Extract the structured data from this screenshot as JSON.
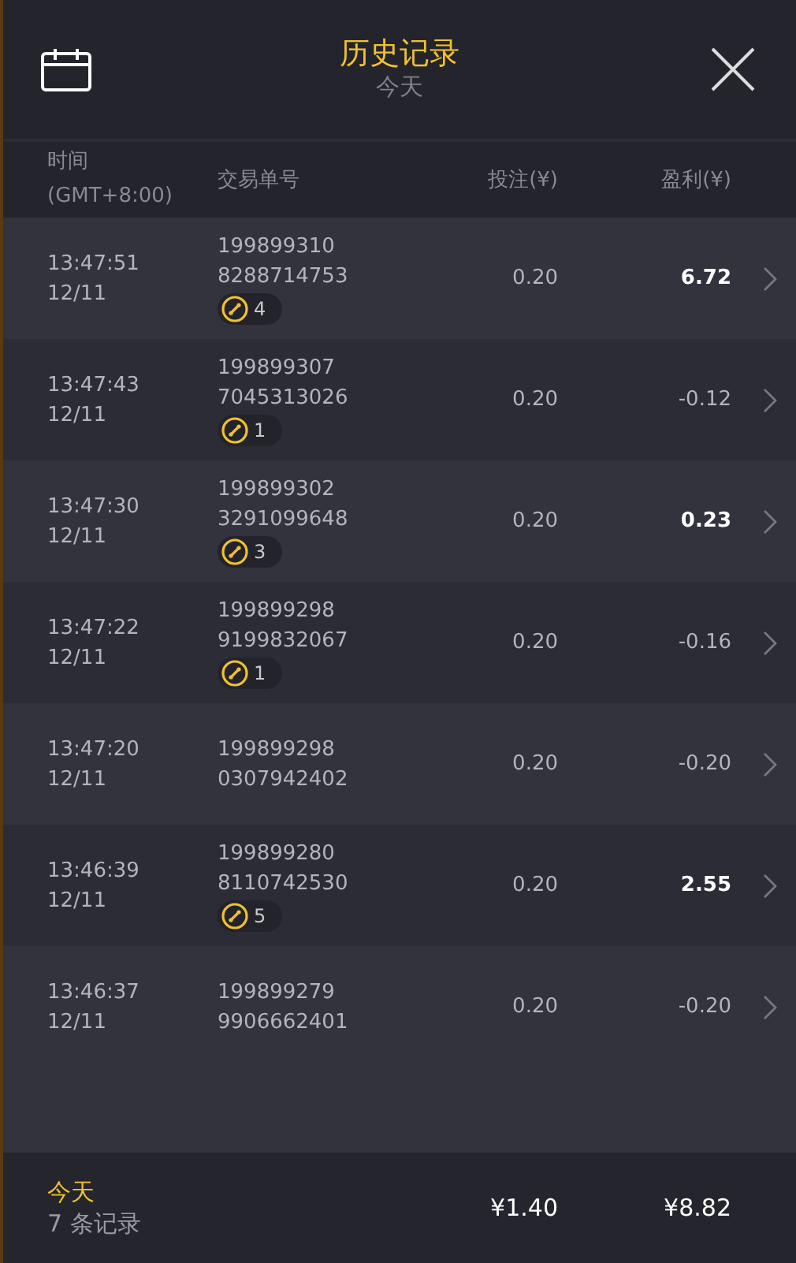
{
  "header": {
    "title": "历史记录",
    "subtitle": "今天"
  },
  "columns": {
    "time": [
      "时间",
      "(GMT+8:00)"
    ],
    "order": "交易单号",
    "stake": "投注(¥)",
    "profit": "盈利(¥)"
  },
  "rows": [
    {
      "time": "13:47:51",
      "date": "12/11",
      "order": [
        "199899310",
        "8288714753"
      ],
      "badge": "4",
      "stake": "0.20",
      "profit": "6.72",
      "highlighted": true
    },
    {
      "time": "13:47:43",
      "date": "12/11",
      "order": [
        "199899307",
        "7045313026"
      ],
      "badge": "1",
      "stake": "0.20",
      "profit": "-0.12",
      "highlighted": false
    },
    {
      "time": "13:47:30",
      "date": "12/11",
      "order": [
        "199899302",
        "3291099648"
      ],
      "badge": "3",
      "stake": "0.20",
      "profit": "0.23",
      "highlighted": true
    },
    {
      "time": "13:47:22",
      "date": "12/11",
      "order": [
        "199899298",
        "9199832067"
      ],
      "badge": "1",
      "stake": "0.20",
      "profit": "-0.16",
      "highlighted": false
    },
    {
      "time": "13:47:20",
      "date": "12/11",
      "order": [
        "199899298",
        "0307942402"
      ],
      "stake": "0.20",
      "profit": "-0.20",
      "highlighted": false
    },
    {
      "time": "13:46:39",
      "date": "12/11",
      "order": [
        "199899280",
        "8110742530"
      ],
      "badge": "5",
      "stake": "0.20",
      "profit": "2.55",
      "highlighted": true
    },
    {
      "time": "13:46:37",
      "date": "12/11",
      "order": [
        "199899279",
        "9906662401"
      ],
      "stake": "0.20",
      "profit": "-0.20",
      "highlighted": false
    }
  ],
  "footer": {
    "label": "今天",
    "count": "7 条记录",
    "stake_total": "¥1.40",
    "profit_total": "¥8.82"
  }
}
